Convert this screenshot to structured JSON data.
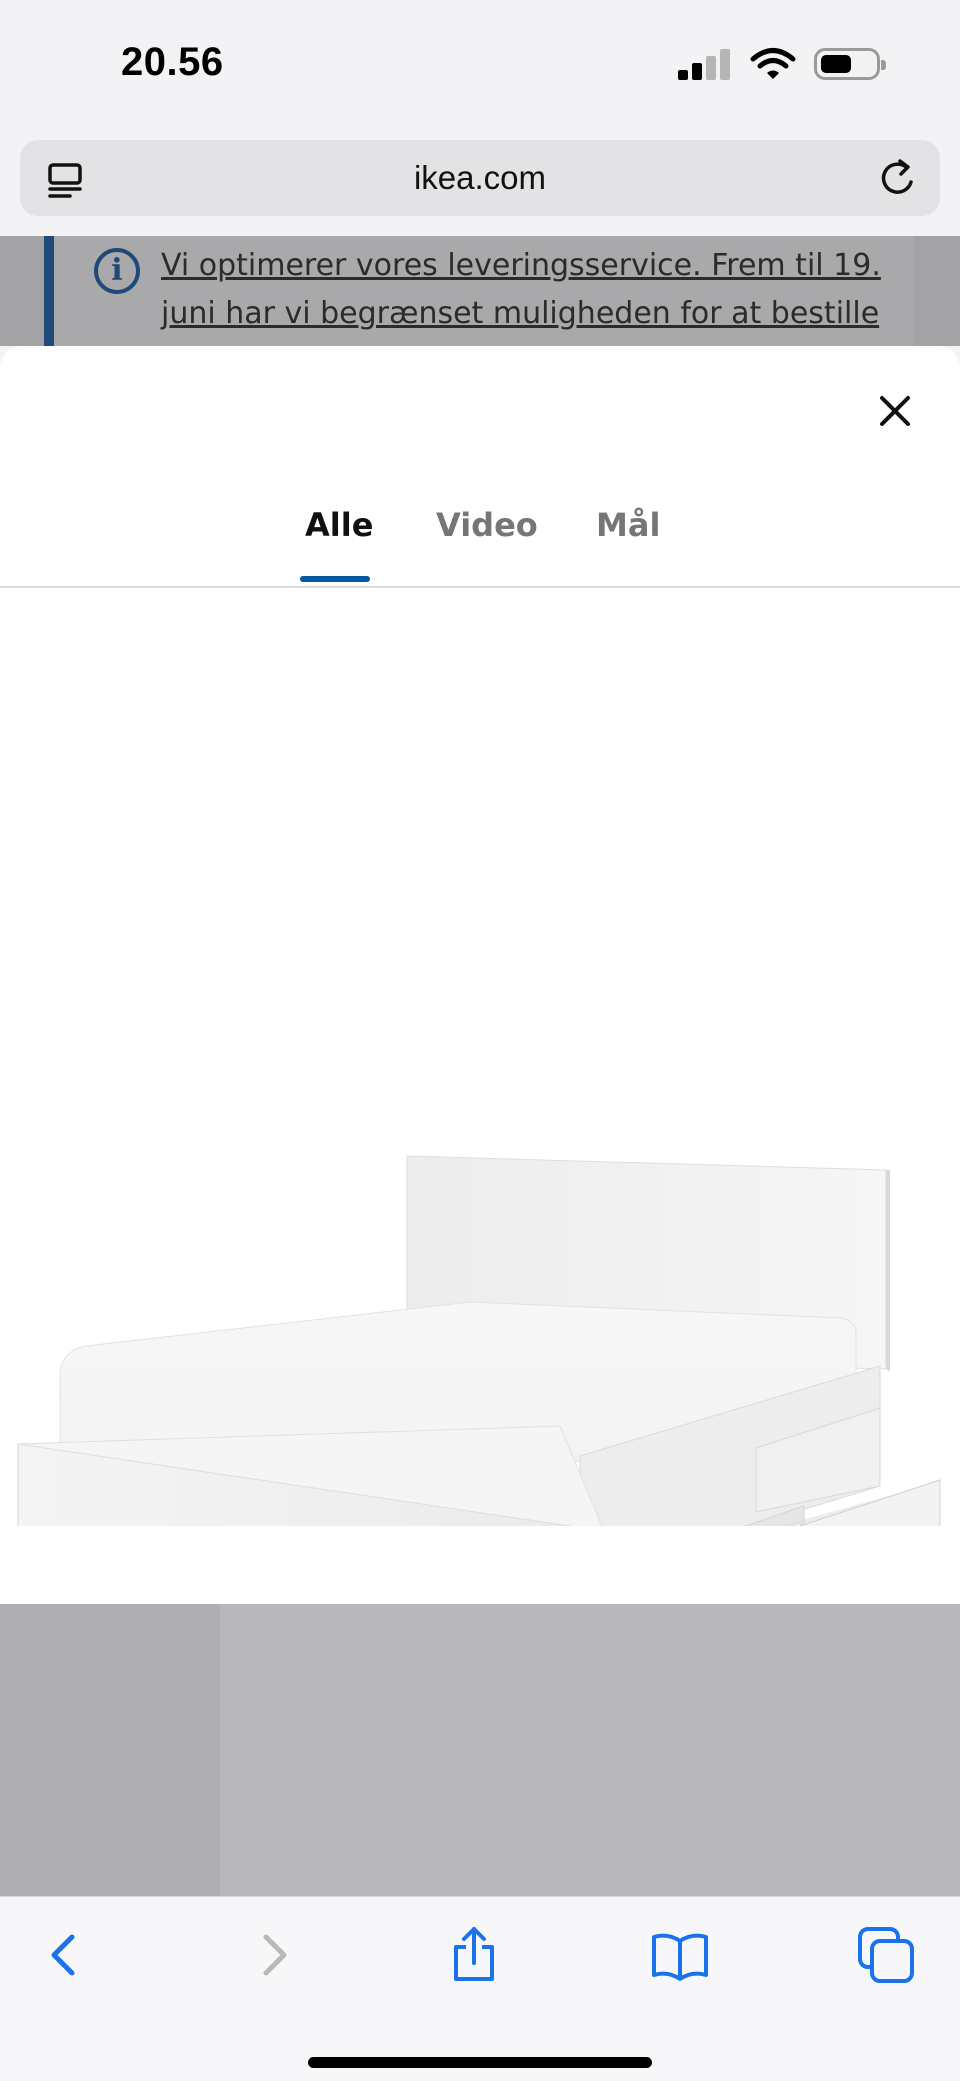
{
  "status_bar": {
    "time": "20.56"
  },
  "browser": {
    "url": "ikea.com"
  },
  "background_page": {
    "banner_text": "Vi optimerer vores leveringsservice. Frem til 19. juni har vi begrænset muligheden for at bestille"
  },
  "gallery": {
    "tabs": [
      {
        "label": "Alle",
        "active": true
      },
      {
        "label": "Video",
        "active": false
      },
      {
        "label": "Mål",
        "active": false
      }
    ],
    "image": "white-bed-with-storage-drawers"
  },
  "toolbar": {
    "icons": [
      "back-icon",
      "forward-icon",
      "share-icon",
      "bookmarks-icon",
      "tabs-icon"
    ]
  },
  "colors": {
    "accent": "#0058a3",
    "safari_blue": "#1a73e8",
    "banner_border": "#1f4a78"
  }
}
